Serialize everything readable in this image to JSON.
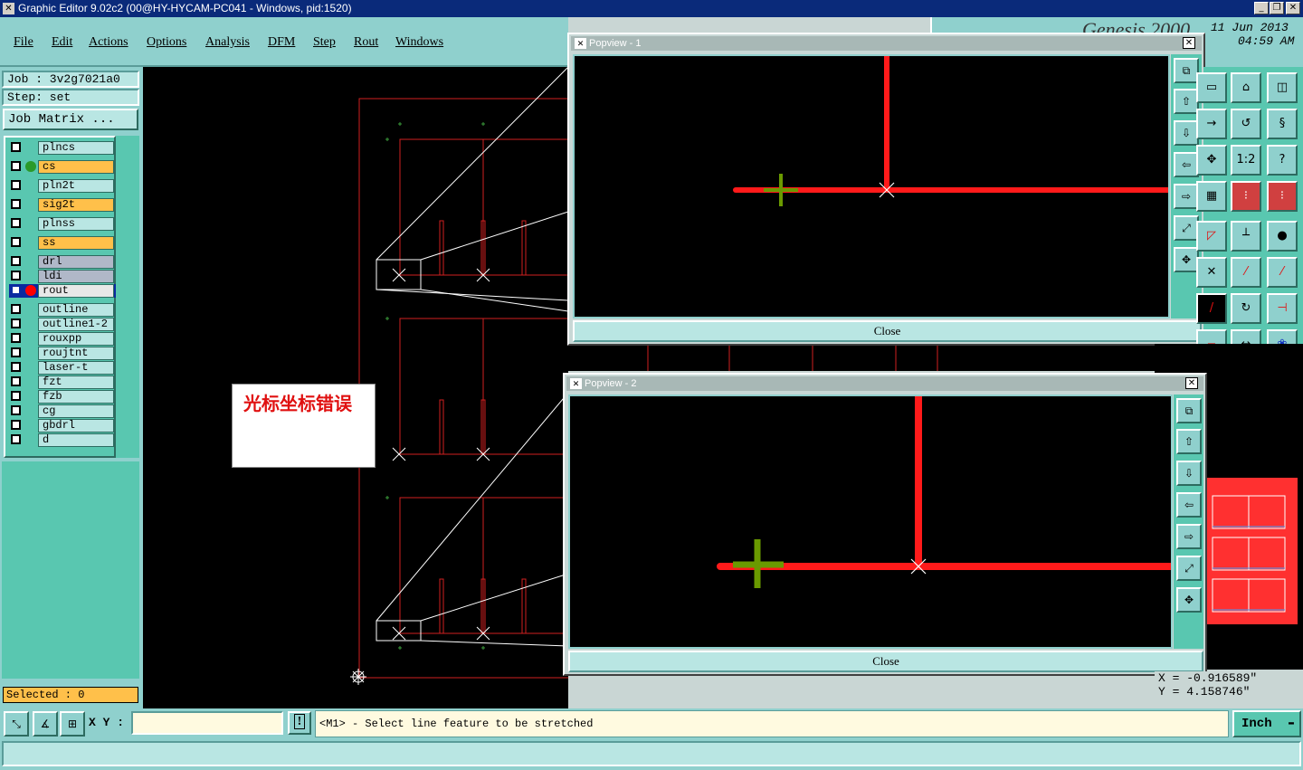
{
  "window": {
    "title": "Graphic Editor 9.02c2 (00@HY-HYCAM-PC041 - Windows, pid:1520)"
  },
  "menu": [
    "File",
    "Edit",
    "Actions",
    "Options",
    "Analysis",
    "DFM",
    "Step",
    "Rout",
    "Windows"
  ],
  "header": {
    "brand": "Genesis 2000",
    "date": "11 Jun 2013",
    "time": "04:59 AM"
  },
  "job": {
    "job_label": "Job : 3v2g7021a0",
    "step_label": "Step: set",
    "matrix_button": "Job Matrix ..."
  },
  "layers": [
    {
      "name": "plncs",
      "highlight": false,
      "dot": ""
    },
    {
      "name": "cs",
      "highlight": true,
      "dot": "#2a9a2a"
    },
    {
      "name": "pln2t",
      "highlight": false,
      "dot": ""
    },
    {
      "name": "sig2t",
      "highlight": true,
      "dot": ""
    },
    {
      "name": "plnss",
      "highlight": false,
      "dot": ""
    },
    {
      "name": "ss",
      "highlight": true,
      "dot": ""
    },
    {
      "name": "drl",
      "highlight": false,
      "dot": ""
    },
    {
      "name": "ldi",
      "highlight": false,
      "dot": ""
    },
    {
      "name": "rout",
      "highlight": false,
      "dot": "#ff0000",
      "active": true
    },
    {
      "name": "outline",
      "highlight": false,
      "dot": ""
    },
    {
      "name": "outline1-2",
      "highlight": false,
      "dot": ""
    },
    {
      "name": "rouxpp",
      "highlight": false,
      "dot": ""
    },
    {
      "name": "roujtnt",
      "highlight": false,
      "dot": ""
    },
    {
      "name": "laser-t",
      "highlight": false,
      "dot": ""
    },
    {
      "name": "fzt",
      "highlight": false,
      "dot": ""
    },
    {
      "name": "fzb",
      "highlight": false,
      "dot": ""
    },
    {
      "name": "cg",
      "highlight": false,
      "dot": ""
    },
    {
      "name": "gbdrl",
      "highlight": false,
      "dot": ""
    },
    {
      "name": "d",
      "highlight": false,
      "dot": ""
    }
  ],
  "selected": "Selected : 0",
  "annotation": "光标坐标错误",
  "popview1": {
    "title": "Popview - 1",
    "close": "Close"
  },
  "popview2": {
    "title": "Popview - 2",
    "close": "Close"
  },
  "coords": {
    "x": "X = -0.916589\"",
    "y": "Y = 4.158746\""
  },
  "bottom": {
    "xy_label": "X Y :",
    "xy_value": "",
    "prompt": "<M1> - Select line feature to be stretched",
    "unit": "Inch",
    "info_button": "!"
  },
  "right_tools": [
    "1:2"
  ],
  "colors": {
    "accent": "#8fd0cd",
    "highlight": "#ffc04a",
    "trace": "#ff0000",
    "cursor": "#55aa00"
  }
}
